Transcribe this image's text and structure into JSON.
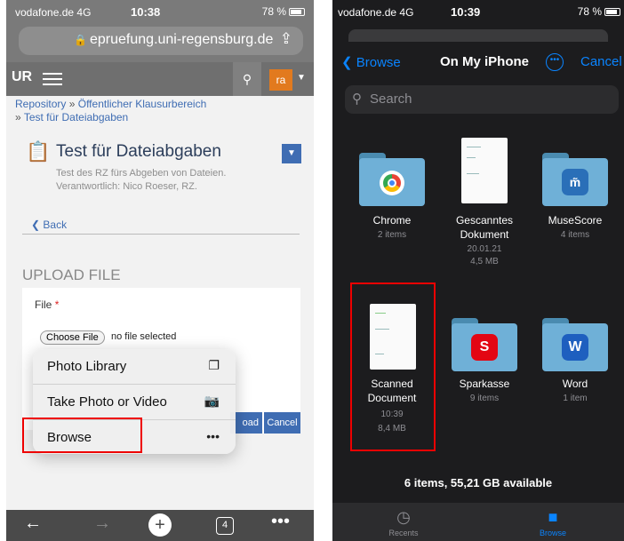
{
  "left": {
    "status": {
      "carrier": "vodafone.de 4G",
      "time": "10:38",
      "battery": "78 %"
    },
    "url": "epruefung.uni-regensburg.de",
    "nav": {
      "logo": "UR",
      "user_initials": "ra"
    },
    "breadcrumb": {
      "root": "Repository",
      "parent": "Öffentlicher Klausurbereich",
      "current": "Test für Dateiabgaben",
      "sep": "»"
    },
    "page_title": "Test für Dateiabgaben",
    "description": [
      "Test des RZ fürs Abgeben von Dateien.",
      "Verantwortlich: Nico Roeser, RZ."
    ],
    "back_label": "Back",
    "section_title": "UPLOAD FILE",
    "file_field": {
      "label": "File",
      "required_mark": "*",
      "choose_label": "Choose File",
      "status": "no file selected"
    },
    "buttons": {
      "upload_partial": "oad",
      "cancel": "Cancel"
    },
    "popup": [
      {
        "label": "Photo Library",
        "icon": "photo-library-icon"
      },
      {
        "label": "Take Photo or Video",
        "icon": "camera-icon"
      },
      {
        "label": "Browse",
        "icon": "ellipsis-icon"
      }
    ],
    "toolbar": {
      "tabs_count": "4"
    }
  },
  "right": {
    "status": {
      "carrier": "vodafone.de 4G",
      "time": "10:39",
      "battery": "78 %"
    },
    "nav": {
      "back": "Browse",
      "title": "On My iPhone",
      "cancel": "Cancel"
    },
    "search_placeholder": "Search",
    "items": [
      {
        "name": "Chrome",
        "sub": [
          "2 items"
        ],
        "kind": "folder",
        "icon": "chrome-icon"
      },
      {
        "name": "Gescanntes Dokument",
        "sub": [
          "20.01.21",
          "4,5 MB"
        ],
        "kind": "document"
      },
      {
        "name": "MuseScore",
        "sub": [
          "4 items"
        ],
        "kind": "folder",
        "icon": "musescore-icon"
      },
      {
        "name": "Scanned Document",
        "sub": [
          "10:39",
          "8,4 MB"
        ],
        "kind": "document"
      },
      {
        "name": "Sparkasse",
        "sub": [
          "9 items"
        ],
        "kind": "folder",
        "icon": "sparkasse-icon"
      },
      {
        "name": "Word",
        "sub": [
          "1 item"
        ],
        "kind": "folder",
        "icon": "word-icon"
      }
    ],
    "footer": "6 items, 55,21 GB available",
    "tabs": [
      {
        "label": "Recents"
      },
      {
        "label": "Browse"
      }
    ]
  },
  "colors": {
    "ios_blue": "#0a84ff",
    "site_blue": "#3f6db3",
    "highlight_red": "#e00000",
    "user_orange": "#e27a1e"
  }
}
